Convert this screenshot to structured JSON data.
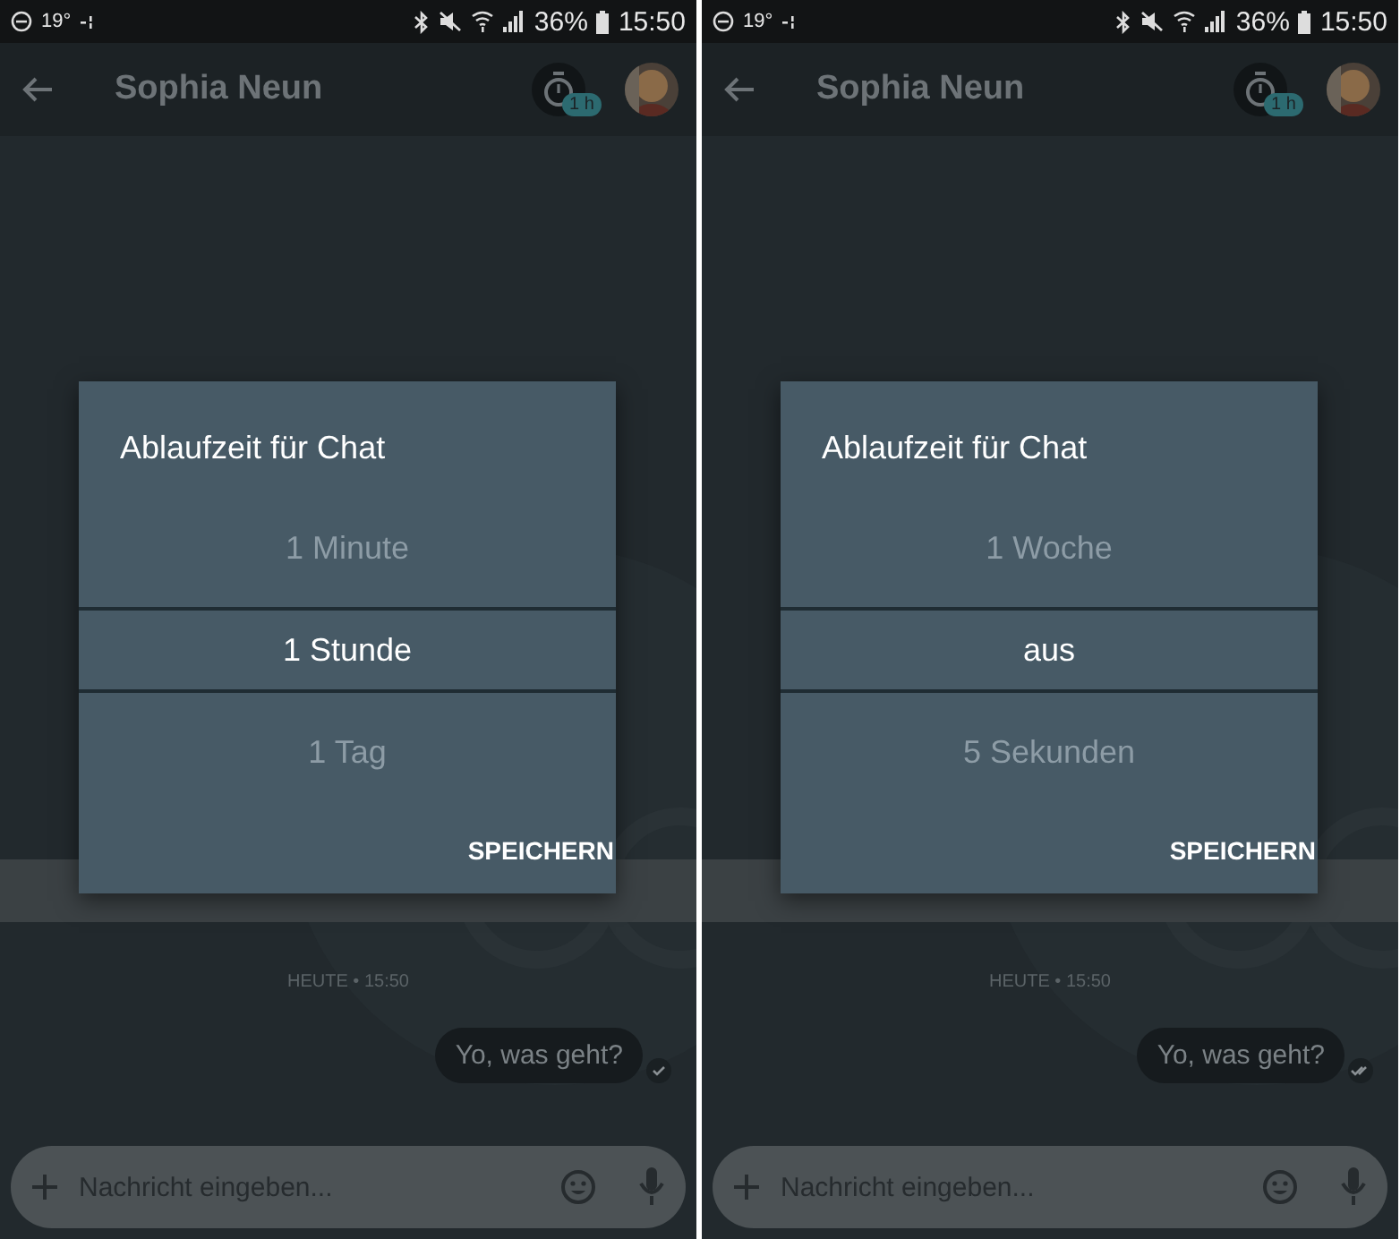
{
  "screens": [
    {
      "status_bar": {
        "temperature": "19°",
        "battery": "36%",
        "time": "15:50"
      },
      "header": {
        "title": "Sophia Neun",
        "timer_badge": "1 h"
      },
      "dialog": {
        "title": "Ablaufzeit für Chat",
        "options": [
          {
            "label": "1 Minute",
            "selected": false
          },
          {
            "label": "1 Stunde",
            "selected": true
          },
          {
            "label": "1 Tag",
            "selected": false
          }
        ],
        "save_button": "SPEICHERN"
      },
      "date_label": "HEUTE • 15:50",
      "messages": [
        {
          "text": "Yo, was geht?",
          "kind": "sent"
        }
      ],
      "composer": {
        "placeholder": "Nachricht eingeben..."
      }
    },
    {
      "status_bar": {
        "temperature": "19°",
        "battery": "36%",
        "time": "15:50"
      },
      "header": {
        "title": "Sophia Neun",
        "timer_badge": "1 h"
      },
      "dialog": {
        "title": "Ablaufzeit für Chat",
        "options": [
          {
            "label": "1 Woche",
            "selected": false
          },
          {
            "label": "aus",
            "selected": true
          },
          {
            "label": "5 Sekunden",
            "selected": false
          }
        ],
        "save_button": "SPEICHERN"
      },
      "date_label": "HEUTE • 15:50",
      "messages": [
        {
          "text": "Yo, was geht?",
          "kind": "delivered"
        }
      ],
      "composer": {
        "placeholder": "Nachricht eingeben..."
      }
    }
  ]
}
